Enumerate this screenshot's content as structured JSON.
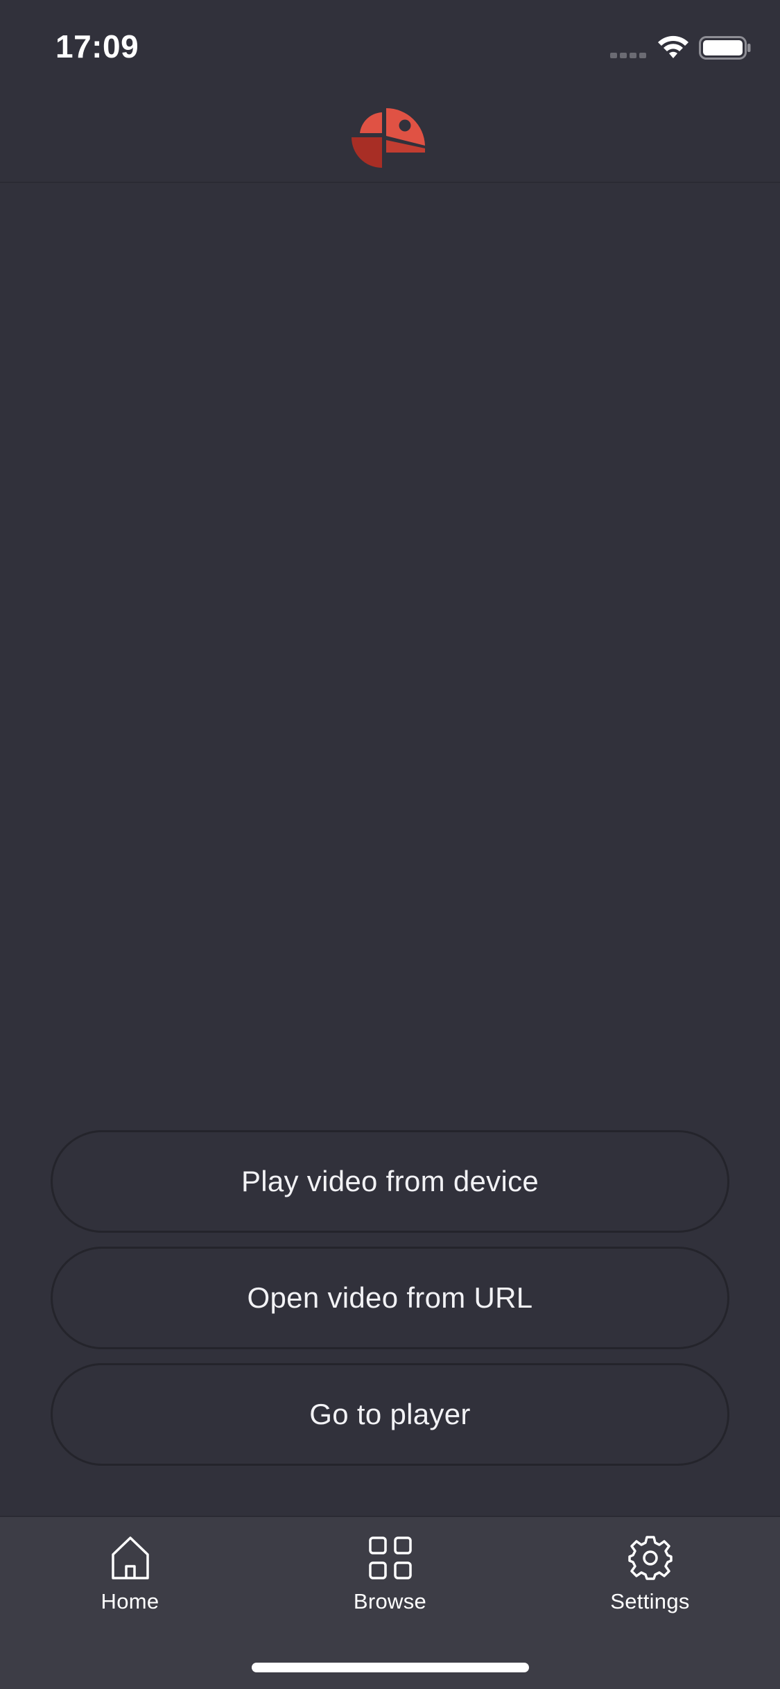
{
  "status_bar": {
    "time": "17:09"
  },
  "header": {
    "logo_icon": "app-logo-icon",
    "brand_colors": [
      "#e05244",
      "#c23d31",
      "#a82e25"
    ]
  },
  "actions": [
    {
      "label": "Play video from device"
    },
    {
      "label": "Open video from URL"
    },
    {
      "label": "Go to player"
    }
  ],
  "tabs": [
    {
      "label": "Home",
      "icon": "home-icon"
    },
    {
      "label": "Browse",
      "icon": "grid-icon"
    },
    {
      "label": "Settings",
      "icon": "gear-icon"
    }
  ],
  "colors": {
    "background": "#31313b",
    "tab_bar": "#3d3d46",
    "button_border": "#24242b",
    "text": "#ffffff"
  }
}
